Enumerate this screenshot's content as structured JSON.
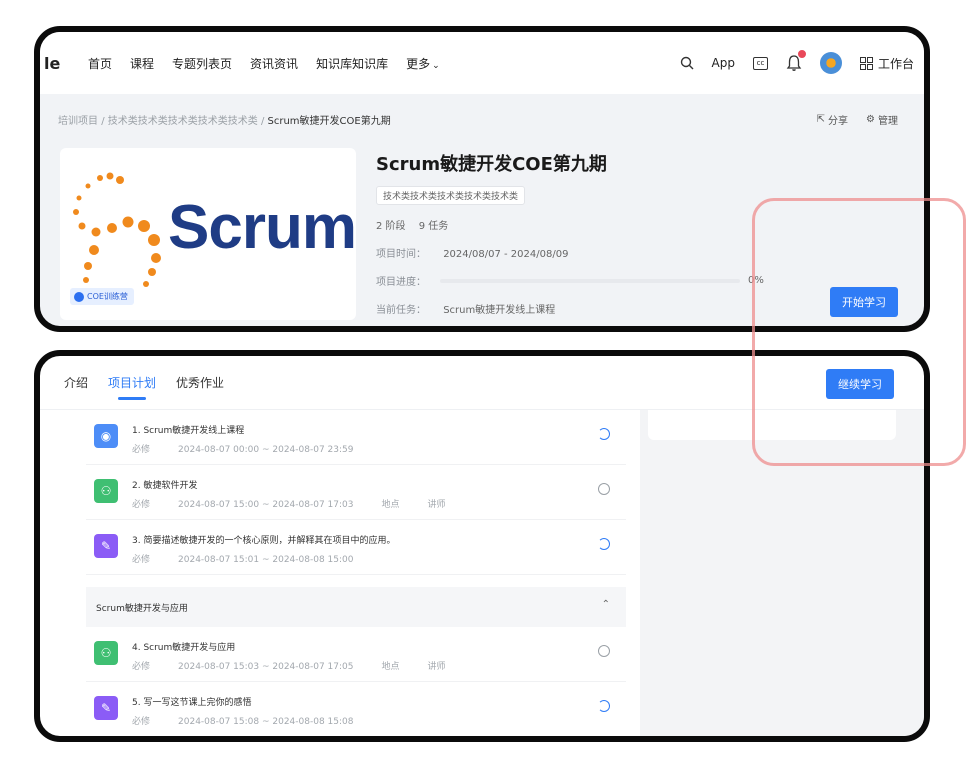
{
  "navbar": {
    "logo_fragment": "le",
    "items": [
      "首页",
      "课程",
      "专题列表页",
      "资讯资讯",
      "知识库知识库",
      "更多"
    ],
    "app_label": "App",
    "cc_label": "cc",
    "workbench_label": "工作台"
  },
  "breadcrumb": {
    "items": [
      "培训项目",
      "技术类技术类技术类技术类技术类"
    ],
    "separator": "/",
    "current": "Scrum敏捷开发COE第九期"
  },
  "top_actions": {
    "share": "分享",
    "manage": "管理"
  },
  "cover": {
    "logo_text": "Scrum",
    "tag": "COE训练营"
  },
  "project": {
    "title": "Scrum敏捷开发COE第九期",
    "category_tag": "技术类技术类技术类技术类技术类",
    "stages": "2 阶段",
    "tasks": "9 任务",
    "time_label": "项目时间：",
    "time_value": "2024/08/07 - 2024/08/09",
    "progress_label": "项目进度：",
    "progress_value": "0%",
    "progress_fraction": 0,
    "current_task_label": "当前任务：",
    "current_task_value": "Scrum敏捷开发线上课程",
    "start_button": "开始学习"
  },
  "tabs": [
    {
      "label": "介绍",
      "active": false
    },
    {
      "label": "项目计划",
      "active": true
    },
    {
      "label": "优秀作业",
      "active": false
    }
  ],
  "continue_button": "继续学习",
  "tasks_stage1": [
    {
      "title": "1. Scrum敏捷开发线上课程",
      "required": "必修",
      "time": "2024-08-07 00:00 ~ 2024-08-07 23:59",
      "location": "",
      "lecturer": "",
      "icon": "course-icon",
      "color": "#4d8df7",
      "status": "in-progress"
    },
    {
      "title": "2. 敏捷软件开发",
      "required": "必修",
      "time": "2024-08-07 15:00 ~ 2024-08-07 17:03",
      "location": "地点",
      "lecturer": "讲师",
      "icon": "offline-class-icon",
      "color": "#3fbf72",
      "status": "not-started"
    },
    {
      "title": "3. 简要描述敏捷开发的一个核心原则，并解释其在项目中的应用。",
      "required": "必修",
      "time": "2024-08-07 15:01 ~ 2024-08-08 15:00",
      "location": "",
      "lecturer": "",
      "icon": "assignment-icon",
      "color": "#8b5cf6",
      "status": "in-progress"
    }
  ],
  "section": {
    "title": "Scrum敏捷开发与应用",
    "caret": "⌃"
  },
  "tasks_stage2": [
    {
      "title": "4. Scrum敏捷开发与应用",
      "required": "必修",
      "time": "2024-08-07 15:03 ~ 2024-08-07 17:05",
      "location": "地点",
      "lecturer": "讲师",
      "icon": "offline-class-icon",
      "color": "#3fbf72",
      "status": "not-started"
    },
    {
      "title": "5. 写一写这节课上完你的感悟",
      "required": "必修",
      "time": "2024-08-07 15:08 ~ 2024-08-08 15:08",
      "location": "",
      "lecturer": "",
      "icon": "assignment-icon",
      "color": "#8b5cf6",
      "status": "in-progress"
    }
  ],
  "colors": {
    "accent": "#2f7cf6",
    "highlight": "#ee8e8e",
    "scrum_blue": "#1f3c85"
  }
}
